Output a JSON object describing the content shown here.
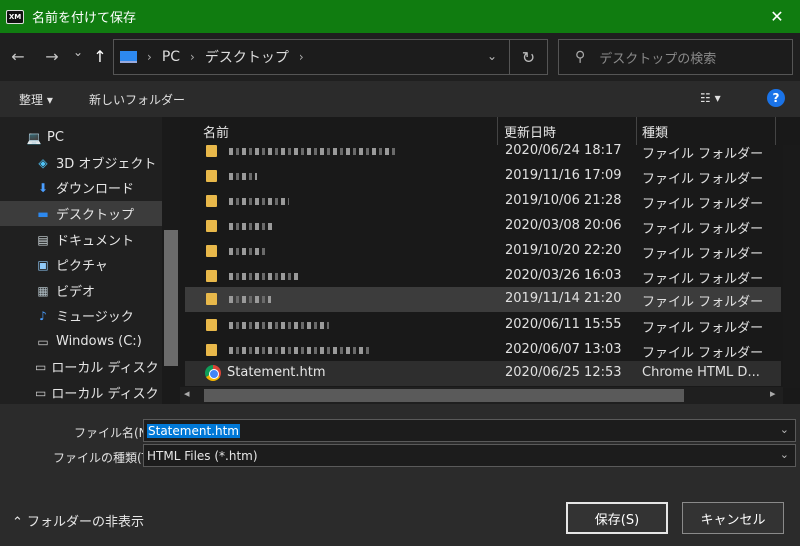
{
  "window": {
    "title": "名前を付けて保存",
    "app_icon_text": "XM",
    "close_glyph": "✕"
  },
  "nav": {
    "back_glyph": "←",
    "forward_glyph": "→",
    "recent_glyph": "⌄",
    "up_glyph": "↑",
    "breadcrumb": [
      "PC",
      "デスクトップ"
    ],
    "breadcrumb_sep": "›",
    "dropdown_glyph": "⌄",
    "refresh_glyph": "↻"
  },
  "search": {
    "placeholder": "デスクトップの検索",
    "icon_glyph": "⚲"
  },
  "toolbar": {
    "organize_label": "整理 ▾",
    "new_folder_label": "新しいフォルダー",
    "view_label": "☷ ▾",
    "help_label": "?"
  },
  "sidebar": {
    "items": [
      {
        "label": "PC",
        "icon": "💻"
      },
      {
        "label": "3D オブジェクト",
        "icon": "◈"
      },
      {
        "label": "ダウンロード",
        "icon": "⬇"
      },
      {
        "label": "デスクトップ",
        "icon": "▬"
      },
      {
        "label": "ドキュメント",
        "icon": "▤"
      },
      {
        "label": "ピクチャ",
        "icon": "▣"
      },
      {
        "label": "ビデオ",
        "icon": "▦"
      },
      {
        "label": "ミュージック",
        "icon": "♪"
      },
      {
        "label": "Windows (C:)",
        "icon": "▭"
      },
      {
        "label": "ローカル ディスク (I:",
        "icon": "▭"
      },
      {
        "label": "ローカル ディスク (J:",
        "icon": "▭"
      }
    ]
  },
  "filelist": {
    "columns": {
      "name": "名前",
      "modified": "更新日時",
      "type": "種類"
    },
    "sort_glyph": "^",
    "rows": [
      {
        "date": "2020/06/24 18:17",
        "type": "ファイル フォルダー"
      },
      {
        "date": "2019/11/16 17:09",
        "type": "ファイル フォルダー"
      },
      {
        "date": "2019/10/06 21:28",
        "type": "ファイル フォルダー"
      },
      {
        "date": "2020/03/08 20:06",
        "type": "ファイル フォルダー"
      },
      {
        "date": "2019/10/20 22:20",
        "type": "ファイル フォルダー"
      },
      {
        "date": "2020/03/26 16:03",
        "type": "ファイル フォルダー"
      },
      {
        "date": "2019/11/14 21:20",
        "type": "ファイル フォルダー"
      },
      {
        "date": "2020/06/11 15:55",
        "type": "ファイル フォルダー"
      },
      {
        "date": "2020/06/07 13:03",
        "type": "ファイル フォルダー"
      },
      {
        "name": "Statement.htm",
        "date": "2020/06/25 12:53",
        "type": "Chrome HTML D..."
      }
    ]
  },
  "form": {
    "filename_label": "ファイル名(N):",
    "filename_value": "Statement.htm",
    "filetype_label": "ファイルの種類(T):",
    "filetype_value": "HTML Files (*.htm)",
    "dropdown_glyph": "⌄"
  },
  "footer": {
    "hide_folders_label": "⌃ フォルダーの非表示",
    "save_label": "保存(S)",
    "cancel_label": "キャンセル"
  }
}
